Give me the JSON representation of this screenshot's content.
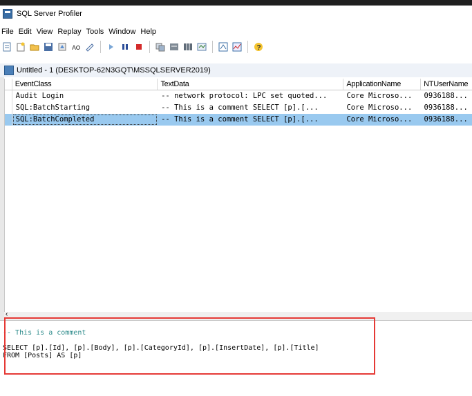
{
  "window": {
    "title": "SQL Server Profiler"
  },
  "menu": [
    "File",
    "Edit",
    "View",
    "Replay",
    "Tools",
    "Window",
    "Help"
  ],
  "toolbar": {
    "icons": [
      "new-trace-icon",
      "new-template-icon",
      "open-icon",
      "save-icon",
      "properties-icon",
      "find-icon",
      "clear-icon",
      "run-icon",
      "pause-icon",
      "stop-icon",
      "templates-icon",
      "trace-properties-icon",
      "columns-icon",
      "filter-icon",
      "tuning-advisor-icon",
      "performance-monitor-icon",
      "help-icon"
    ]
  },
  "document": {
    "title": "Untitled - 1 (DESKTOP-62N3GQT\\MSSQLSERVER2019)"
  },
  "grid": {
    "columns": [
      "EventClass",
      "TextData",
      "ApplicationName",
      "NTUserName"
    ],
    "rows": [
      [
        "Audit Login",
        "-- network protocol: LPC  set quoted...",
        "Core Microso...",
        "0936188..."
      ],
      [
        "SQL:BatchStarting",
        "-- This is a comment    SELECT [p].[...",
        "Core Microso...",
        "0936188..."
      ],
      [
        "SQL:BatchCompleted",
        "-- This is a comment    SELECT [p].[...",
        "Core Microso...",
        "0936188..."
      ]
    ],
    "selected_row": 2
  },
  "detail": {
    "comment": "-- This is a comment",
    "line1": "SELECT [p].[Id], [p].[Body], [p].[CategoryId], [p].[InsertDate], [p].[Title]",
    "line2": "FROM [Posts] AS [p]"
  },
  "colors": {
    "selection": "#99c9ef",
    "highlight_box": "#e53935",
    "comment": "#2e8b8b"
  }
}
